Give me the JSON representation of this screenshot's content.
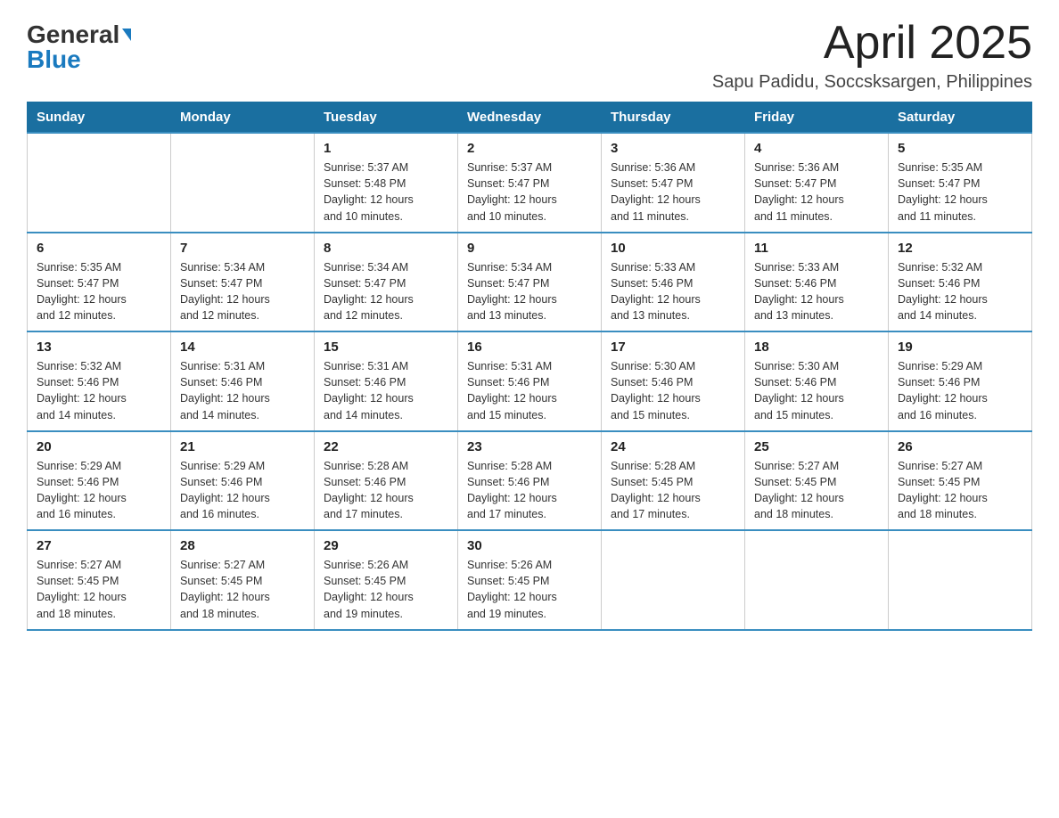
{
  "header": {
    "logo_general": "General",
    "logo_blue": "Blue",
    "month_title": "April 2025",
    "location": "Sapu Padidu, Soccsksargen, Philippines"
  },
  "weekdays": [
    "Sunday",
    "Monday",
    "Tuesday",
    "Wednesday",
    "Thursday",
    "Friday",
    "Saturday"
  ],
  "weeks": [
    [
      {
        "day": "",
        "info": ""
      },
      {
        "day": "",
        "info": ""
      },
      {
        "day": "1",
        "info": "Sunrise: 5:37 AM\nSunset: 5:48 PM\nDaylight: 12 hours\nand 10 minutes."
      },
      {
        "day": "2",
        "info": "Sunrise: 5:37 AM\nSunset: 5:47 PM\nDaylight: 12 hours\nand 10 minutes."
      },
      {
        "day": "3",
        "info": "Sunrise: 5:36 AM\nSunset: 5:47 PM\nDaylight: 12 hours\nand 11 minutes."
      },
      {
        "day": "4",
        "info": "Sunrise: 5:36 AM\nSunset: 5:47 PM\nDaylight: 12 hours\nand 11 minutes."
      },
      {
        "day": "5",
        "info": "Sunrise: 5:35 AM\nSunset: 5:47 PM\nDaylight: 12 hours\nand 11 minutes."
      }
    ],
    [
      {
        "day": "6",
        "info": "Sunrise: 5:35 AM\nSunset: 5:47 PM\nDaylight: 12 hours\nand 12 minutes."
      },
      {
        "day": "7",
        "info": "Sunrise: 5:34 AM\nSunset: 5:47 PM\nDaylight: 12 hours\nand 12 minutes."
      },
      {
        "day": "8",
        "info": "Sunrise: 5:34 AM\nSunset: 5:47 PM\nDaylight: 12 hours\nand 12 minutes."
      },
      {
        "day": "9",
        "info": "Sunrise: 5:34 AM\nSunset: 5:47 PM\nDaylight: 12 hours\nand 13 minutes."
      },
      {
        "day": "10",
        "info": "Sunrise: 5:33 AM\nSunset: 5:46 PM\nDaylight: 12 hours\nand 13 minutes."
      },
      {
        "day": "11",
        "info": "Sunrise: 5:33 AM\nSunset: 5:46 PM\nDaylight: 12 hours\nand 13 minutes."
      },
      {
        "day": "12",
        "info": "Sunrise: 5:32 AM\nSunset: 5:46 PM\nDaylight: 12 hours\nand 14 minutes."
      }
    ],
    [
      {
        "day": "13",
        "info": "Sunrise: 5:32 AM\nSunset: 5:46 PM\nDaylight: 12 hours\nand 14 minutes."
      },
      {
        "day": "14",
        "info": "Sunrise: 5:31 AM\nSunset: 5:46 PM\nDaylight: 12 hours\nand 14 minutes."
      },
      {
        "day": "15",
        "info": "Sunrise: 5:31 AM\nSunset: 5:46 PM\nDaylight: 12 hours\nand 14 minutes."
      },
      {
        "day": "16",
        "info": "Sunrise: 5:31 AM\nSunset: 5:46 PM\nDaylight: 12 hours\nand 15 minutes."
      },
      {
        "day": "17",
        "info": "Sunrise: 5:30 AM\nSunset: 5:46 PM\nDaylight: 12 hours\nand 15 minutes."
      },
      {
        "day": "18",
        "info": "Sunrise: 5:30 AM\nSunset: 5:46 PM\nDaylight: 12 hours\nand 15 minutes."
      },
      {
        "day": "19",
        "info": "Sunrise: 5:29 AM\nSunset: 5:46 PM\nDaylight: 12 hours\nand 16 minutes."
      }
    ],
    [
      {
        "day": "20",
        "info": "Sunrise: 5:29 AM\nSunset: 5:46 PM\nDaylight: 12 hours\nand 16 minutes."
      },
      {
        "day": "21",
        "info": "Sunrise: 5:29 AM\nSunset: 5:46 PM\nDaylight: 12 hours\nand 16 minutes."
      },
      {
        "day": "22",
        "info": "Sunrise: 5:28 AM\nSunset: 5:46 PM\nDaylight: 12 hours\nand 17 minutes."
      },
      {
        "day": "23",
        "info": "Sunrise: 5:28 AM\nSunset: 5:46 PM\nDaylight: 12 hours\nand 17 minutes."
      },
      {
        "day": "24",
        "info": "Sunrise: 5:28 AM\nSunset: 5:45 PM\nDaylight: 12 hours\nand 17 minutes."
      },
      {
        "day": "25",
        "info": "Sunrise: 5:27 AM\nSunset: 5:45 PM\nDaylight: 12 hours\nand 18 minutes."
      },
      {
        "day": "26",
        "info": "Sunrise: 5:27 AM\nSunset: 5:45 PM\nDaylight: 12 hours\nand 18 minutes."
      }
    ],
    [
      {
        "day": "27",
        "info": "Sunrise: 5:27 AM\nSunset: 5:45 PM\nDaylight: 12 hours\nand 18 minutes."
      },
      {
        "day": "28",
        "info": "Sunrise: 5:27 AM\nSunset: 5:45 PM\nDaylight: 12 hours\nand 18 minutes."
      },
      {
        "day": "29",
        "info": "Sunrise: 5:26 AM\nSunset: 5:45 PM\nDaylight: 12 hours\nand 19 minutes."
      },
      {
        "day": "30",
        "info": "Sunrise: 5:26 AM\nSunset: 5:45 PM\nDaylight: 12 hours\nand 19 minutes."
      },
      {
        "day": "",
        "info": ""
      },
      {
        "day": "",
        "info": ""
      },
      {
        "day": "",
        "info": ""
      }
    ]
  ]
}
